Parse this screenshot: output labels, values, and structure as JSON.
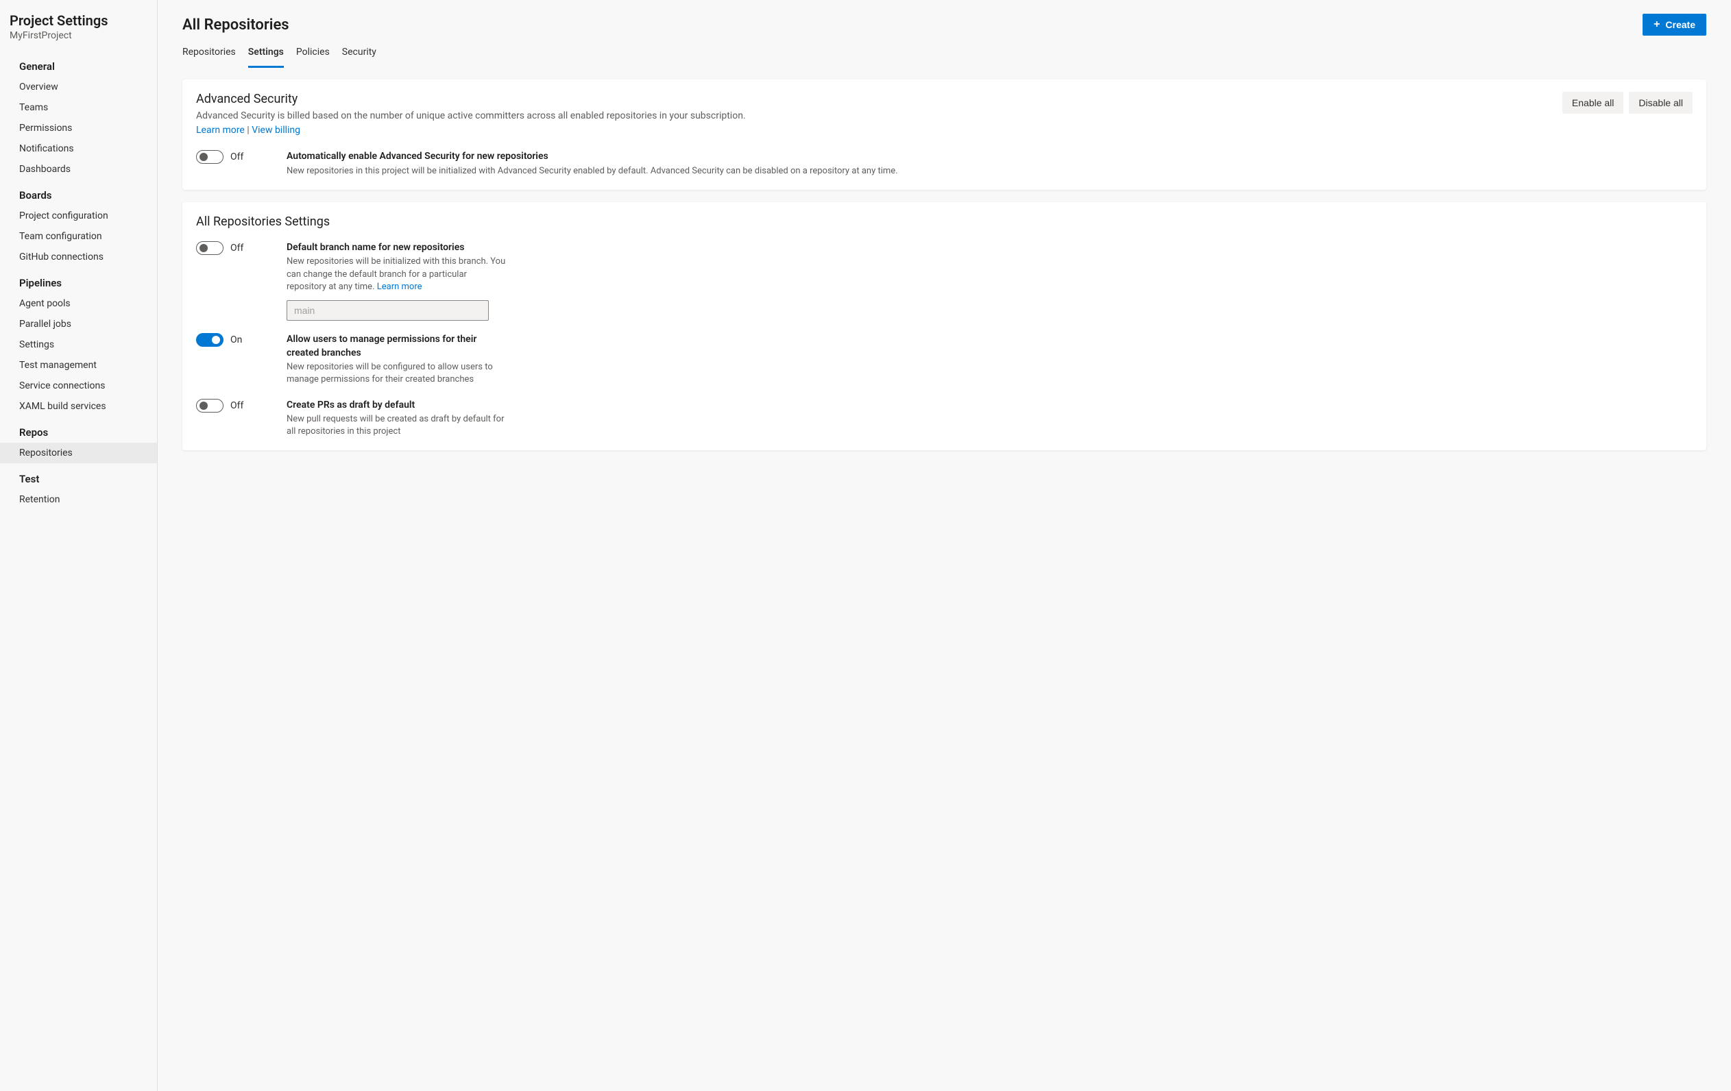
{
  "sidebar": {
    "title": "Project Settings",
    "subtitle": "MyFirstProject",
    "groups": [
      {
        "title": "General",
        "items": [
          {
            "label": "Overview",
            "selected": false
          },
          {
            "label": "Teams",
            "selected": false
          },
          {
            "label": "Permissions",
            "selected": false
          },
          {
            "label": "Notifications",
            "selected": false
          },
          {
            "label": "Dashboards",
            "selected": false
          }
        ]
      },
      {
        "title": "Boards",
        "items": [
          {
            "label": "Project configuration",
            "selected": false
          },
          {
            "label": "Team configuration",
            "selected": false
          },
          {
            "label": "GitHub connections",
            "selected": false
          }
        ]
      },
      {
        "title": "Pipelines",
        "items": [
          {
            "label": "Agent pools",
            "selected": false
          },
          {
            "label": "Parallel jobs",
            "selected": false
          },
          {
            "label": "Settings",
            "selected": false
          },
          {
            "label": "Test management",
            "selected": false
          },
          {
            "label": "Service connections",
            "selected": false
          },
          {
            "label": "XAML build services",
            "selected": false
          }
        ]
      },
      {
        "title": "Repos",
        "items": [
          {
            "label": "Repositories",
            "selected": true
          }
        ]
      },
      {
        "title": "Test",
        "items": [
          {
            "label": "Retention",
            "selected": false
          }
        ]
      }
    ]
  },
  "page": {
    "title": "All Repositories",
    "create_label": "Create"
  },
  "tabs": [
    {
      "label": "Repositories",
      "active": false
    },
    {
      "label": "Settings",
      "active": true
    },
    {
      "label": "Policies",
      "active": false
    },
    {
      "label": "Security",
      "active": false
    }
  ],
  "advSecurity": {
    "title": "Advanced Security",
    "desc": "Advanced Security is billed based on the number of unique active committers across all enabled repositories in your subscription.",
    "learn_more": "Learn more",
    "sep": " | ",
    "view_billing": "View billing",
    "enable_all": "Enable all",
    "disable_all": "Disable all",
    "auto": {
      "state": "Off",
      "title": "Automatically enable Advanced Security for new repositories",
      "desc": "New repositories in this project will be initialized with Advanced Security enabled by default. Advanced Security can be disabled on a repository at any time."
    }
  },
  "repoSettings": {
    "title": "All Repositories Settings",
    "defaultBranch": {
      "state": "Off",
      "title": "Default branch name for new repositories",
      "desc": "New repositories will be initialized with this branch. You can change the default branch for a particular repository at any time. ",
      "learn_more": "Learn more",
      "input_value": "main"
    },
    "managePerms": {
      "state": "On",
      "title": "Allow users to manage permissions for their created branches",
      "desc": "New repositories will be configured to allow users to manage permissions for their created branches"
    },
    "draftPR": {
      "state": "Off",
      "title": "Create PRs as draft by default",
      "desc": "New pull requests will be created as draft by default for all repositories in this project"
    }
  }
}
